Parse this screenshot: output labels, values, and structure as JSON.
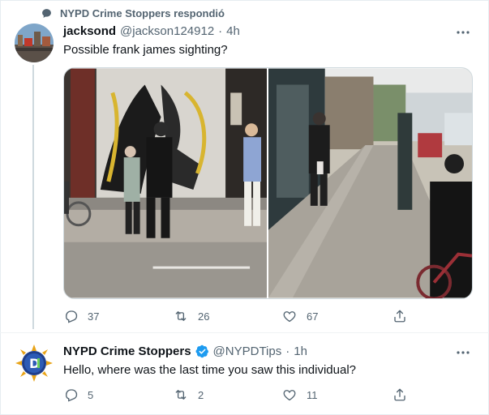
{
  "context": {
    "text": "NYPD Crime Stoppers respondió"
  },
  "tweet1": {
    "name": "jacksond",
    "handle": "@jackson124912",
    "dot": "·",
    "time": "4h",
    "text": "Possible frank james sighting?",
    "actions": {
      "replies": "37",
      "retweets": "26",
      "likes": "67"
    }
  },
  "tweet2": {
    "name": "NYPD Crime Stoppers",
    "handle": "@NYPDTips",
    "dot": "·",
    "time": "1h",
    "text": "Hello, where was the last time you saw this individual?",
    "actions": {
      "replies": "5",
      "retweets": "2",
      "likes": "11"
    }
  },
  "colors": {
    "accent": "#1d9bf0",
    "secondary_text": "#536471",
    "verified": "#1d9bf0"
  },
  "icons": [
    "reply-icon",
    "retweet-icon",
    "like-icon",
    "share-icon",
    "more-icon",
    "verified-badge-icon",
    "speech-bubble-icon"
  ]
}
